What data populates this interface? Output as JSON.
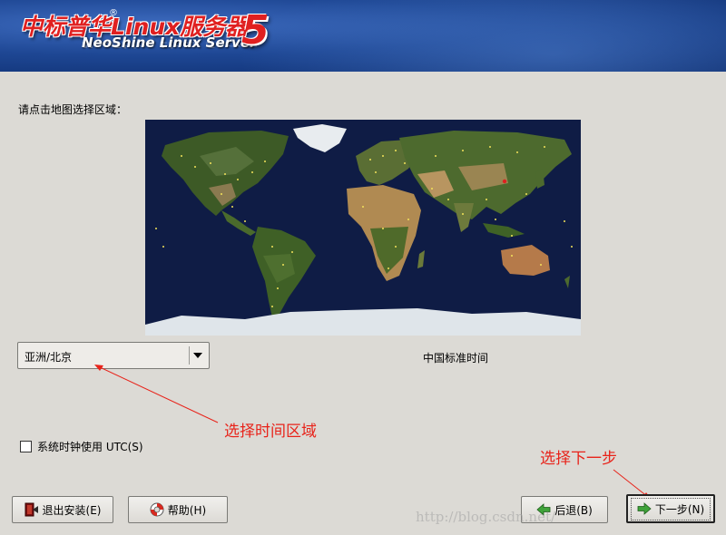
{
  "header": {
    "brand_cn": "中标普华",
    "brand_linux": "Linux服务器",
    "brand_reg": "®",
    "brand_en": "NeoShine Linux Server",
    "version": "5"
  },
  "prompt": "请点击地图选择区域：",
  "timezone": {
    "selected": "亚洲/北京",
    "description": "中国标准时间"
  },
  "annotations": {
    "timezone": "选择时间区域",
    "next": "选择下一步"
  },
  "utc": {
    "label": "系统时钟使用 UTC(S)",
    "checked": false
  },
  "buttons": {
    "exit": "退出安装(E)",
    "help": "帮助(H)",
    "back": "后退(B)",
    "next": "下一步(N)"
  },
  "watermark": "http://blog.csdn.net/",
  "colors": {
    "annotation": "#e8231a",
    "ocean": "#0f1c45",
    "header": "#1e4794"
  }
}
